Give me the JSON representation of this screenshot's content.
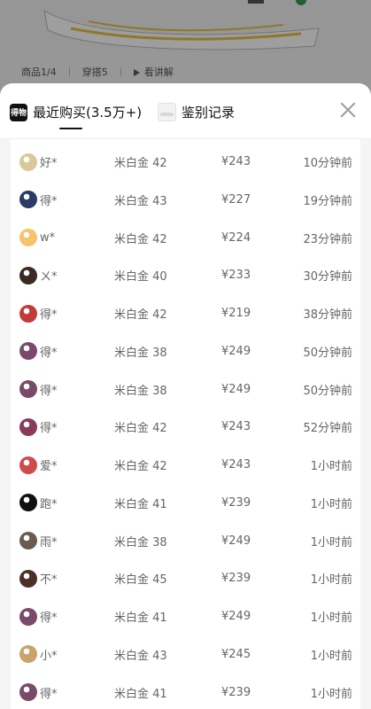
{
  "background_page": {
    "meta": {
      "product_index": "商品1/4",
      "outfit": "穿搭5",
      "explain": "看讲解"
    }
  },
  "tabs": {
    "recent_logo_text": "得物",
    "recent_label": "最近购买(3.5万+)",
    "auth_label": "鉴别记录"
  },
  "purchases": [
    {
      "name": "好*",
      "size": "米白金 42",
      "price": "¥243",
      "time": "10分钟前",
      "avatar_color": "#d9c99a"
    },
    {
      "name": "得*",
      "size": "米白金 43",
      "price": "¥227",
      "time": "19分钟前",
      "avatar_color": "#2b3a66"
    },
    {
      "name": "w*",
      "size": "米白金 42",
      "price": "¥224",
      "time": "23分钟前",
      "avatar_color": "#f3c46a"
    },
    {
      "name": "ㄨ*",
      "size": "米白金 40",
      "price": "¥233",
      "time": "30分钟前",
      "avatar_color": "#3b2a22"
    },
    {
      "name": "得*",
      "size": "米白金 42",
      "price": "¥219",
      "time": "38分钟前",
      "avatar_color": "#c23b3b"
    },
    {
      "name": "得*",
      "size": "米白金 38",
      "price": "¥249",
      "time": "50分钟前",
      "avatar_color": "#7a4a6a"
    },
    {
      "name": "得*",
      "size": "米白金 38",
      "price": "¥249",
      "time": "50分钟前",
      "avatar_color": "#7a4a6a"
    },
    {
      "name": "得*",
      "size": "米白金 42",
      "price": "¥243",
      "time": "52分钟前",
      "avatar_color": "#8a3a5a"
    },
    {
      "name": "爱*",
      "size": "米白金 42",
      "price": "¥243",
      "time": "1小时前",
      "avatar_color": "#d04a4a"
    },
    {
      "name": "跑*",
      "size": "米白金 41",
      "price": "¥239",
      "time": "1小时前",
      "avatar_color": "#111111"
    },
    {
      "name": "雨*",
      "size": "米白金 38",
      "price": "¥249",
      "time": "1小时前",
      "avatar_color": "#6b5b4f"
    },
    {
      "name": "不*",
      "size": "米白金 45",
      "price": "¥239",
      "time": "1小时前",
      "avatar_color": "#4a3026"
    },
    {
      "name": "得*",
      "size": "米白金 41",
      "price": "¥249",
      "time": "1小时前",
      "avatar_color": "#7a4a6a"
    },
    {
      "name": "小*",
      "size": "米白金 43",
      "price": "¥245",
      "time": "1小时前",
      "avatar_color": "#c9a36a"
    },
    {
      "name": "得*",
      "size": "米白金 41",
      "price": "¥239",
      "time": "1小时前",
      "avatar_color": "#7a4a6a"
    }
  ]
}
